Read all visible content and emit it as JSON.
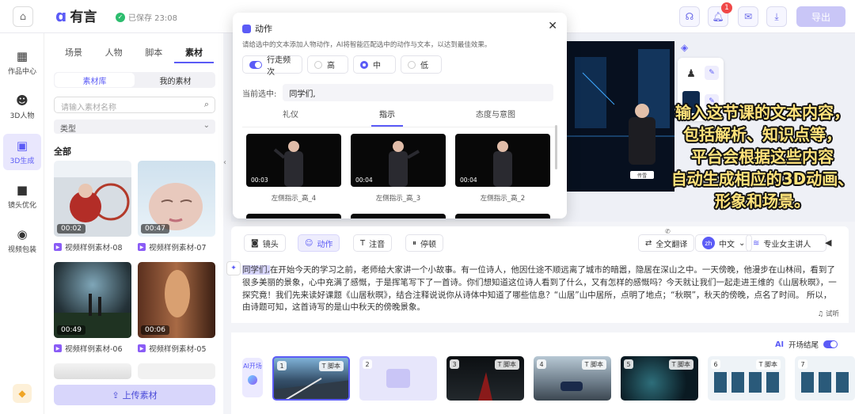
{
  "header": {
    "logo_text": "有言",
    "saved": "已保存 23:08",
    "notif_count": "1",
    "export": "导出"
  },
  "nav": [
    {
      "label": "作品中心",
      "icon": "grid-icon"
    },
    {
      "label": "3D人物",
      "icon": "avatar-icon"
    },
    {
      "label": "3D生成",
      "icon": "chart-icon"
    },
    {
      "label": "镜头优化",
      "icon": "camera-icon"
    },
    {
      "label": "视频包装",
      "icon": "film-reel-icon"
    }
  ],
  "panel": {
    "tabs": [
      "场景",
      "人物",
      "脚本",
      "素材"
    ],
    "seg": [
      "素材库",
      "我的素材"
    ],
    "search_placeholder": "请输入素材名称",
    "type_label": "类型",
    "all": "全部",
    "upload": "上传素材",
    "cards": [
      {
        "duration": "00:02",
        "label": "视频样例素材-08"
      },
      {
        "duration": "00:47",
        "label": "视频样例素材-07"
      },
      {
        "duration": "00:49",
        "label": "视频样例素材-06"
      },
      {
        "duration": "00:06",
        "label": "视频样例素材-05"
      }
    ]
  },
  "modal": {
    "title": "动作",
    "desc": "请给选中的文本添加人物动作，AI将智能匹配选中的动作与文本，以达到最佳效果。",
    "freq_label": "行走频次",
    "options": [
      "高",
      "中",
      "低"
    ],
    "current_label": "当前选中:",
    "current_value": "同学们,",
    "tabs": [
      "礼仪",
      "指示",
      "态度与意图"
    ],
    "previews": [
      {
        "time": "00:03",
        "label": "左侧指示_高_4"
      },
      {
        "time": "00:04",
        "label": "左侧指示_高_3"
      },
      {
        "time": "00:04",
        "label": "左侧指示_高_2"
      }
    ]
  },
  "stage": {
    "caption": "传雪"
  },
  "overlay": [
    "输入这节课的文本内容，",
    "包括解析、知识点等，",
    "平台会根据这些内容",
    "自动生成相应的3D动画、",
    "形象和场景。"
  ],
  "toolbar": {
    "shot": "镜头",
    "action": "动作",
    "note": "注音",
    "pause": "停顿",
    "translate": "全文翻译",
    "lang_code": "zh",
    "lang": "中文",
    "voice": "专业女主讲人"
  },
  "editor": {
    "highlight": "同学们,",
    "text": "在开始今天的学习之前，老师给大家讲一个小故事。有一位诗人，他因仕途不顺远离了城市的暗嚣，隐居在深山之中。一天傍晚，他漫步在山林间，看到了很多美丽的景象，心中充满了感慨，于是挥笔写下了一首诗。你们想知道这位诗人看到了什么，又有怎样的感慨吗？今天就让我们一起走进王维的《山居秋暝》，一探究竟！我们先来读好课题《山居秋暝》，结合注释说说你从诗体中知道了哪些信息？“山居”山中居所，点明了地点；“秋暝”，秋天的傍晚，点名了时间。 所以，由诗题可知，这首诗写的是山中秋天的傍晚景象。",
    "try": "试听"
  },
  "strip": {
    "kt_ai": "AI",
    "kt": "开场结尾",
    "ai_btn": "AI开场",
    "script_tag": "脚本",
    "scenes": [
      "1",
      "2",
      "3",
      "4",
      "5",
      "6",
      "7"
    ]
  }
}
